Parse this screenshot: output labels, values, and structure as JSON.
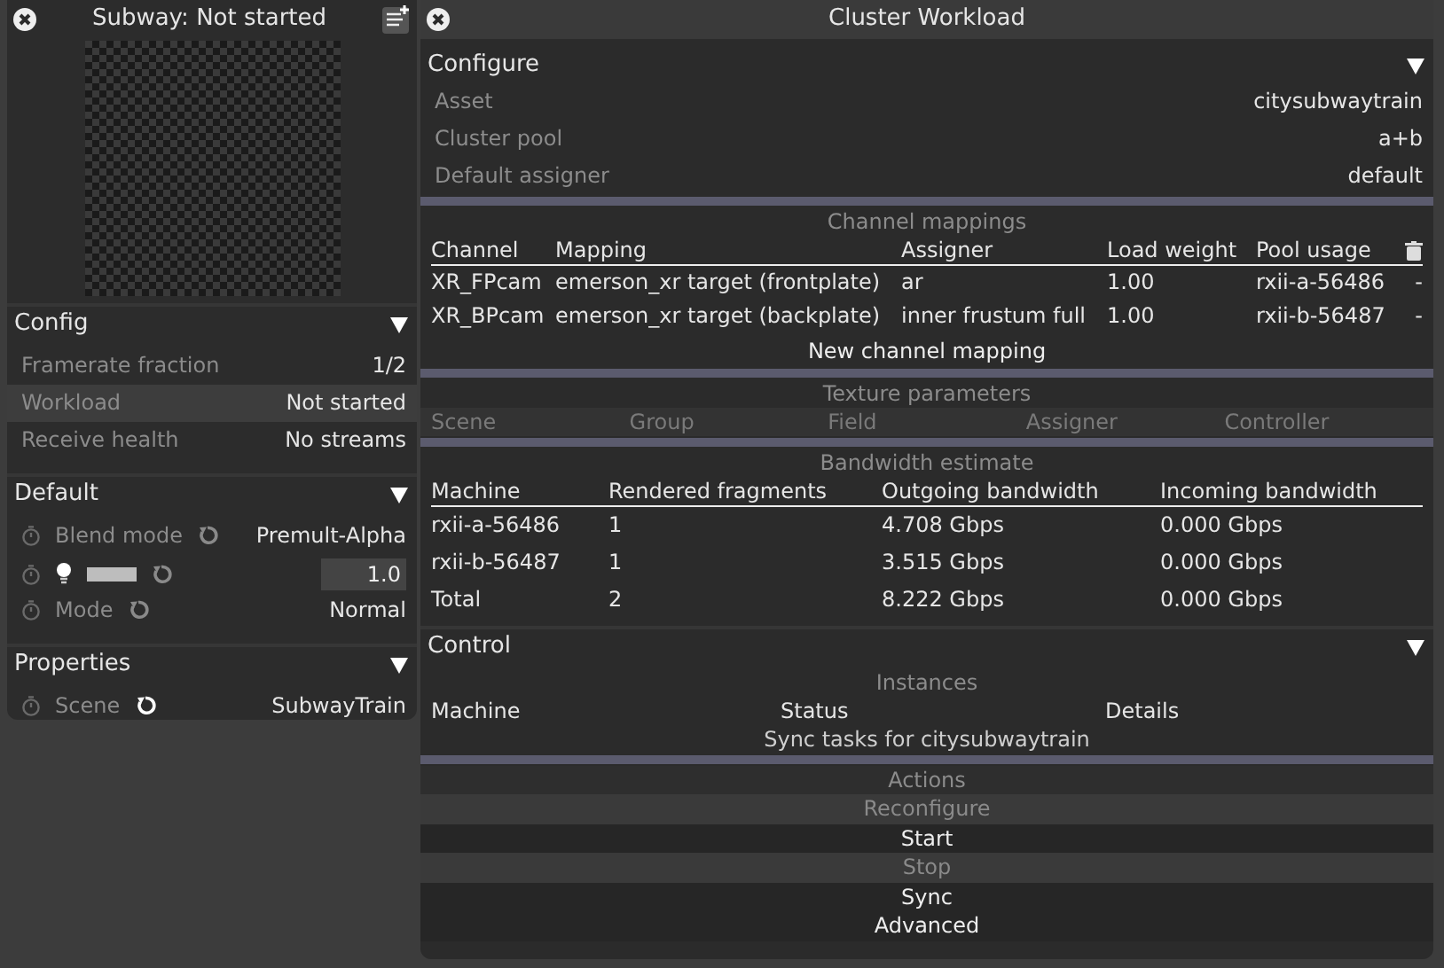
{
  "left_panel": {
    "title": "Subway: Not started",
    "sections": [
      {
        "title": "Config",
        "expanded": true,
        "rows": [
          {
            "kind": "info",
            "label": "Framerate fraction",
            "value": "1/2",
            "selected": false
          },
          {
            "kind": "info",
            "label": "Workload",
            "value": "Not started",
            "selected": true
          },
          {
            "kind": "info",
            "label": "Receive health",
            "value": "No streams",
            "selected": false
          }
        ]
      },
      {
        "title": "Default",
        "expanded": true,
        "rows": [
          {
            "kind": "select",
            "label": "Blend mode",
            "value": "Premult-Alpha",
            "modified": false
          },
          {
            "kind": "slider",
            "level": 1.0,
            "value": "1.0",
            "modified": false
          },
          {
            "kind": "select",
            "label": "Mode",
            "value": "Normal",
            "modified": false
          }
        ]
      },
      {
        "title": "Properties",
        "expanded": true,
        "rows": [
          {
            "kind": "select",
            "label": "Scene",
            "value": "SubwayTrain",
            "modified": true
          }
        ]
      }
    ]
  },
  "main_panel": {
    "title": "Cluster Workload",
    "configure": {
      "title": "Configure",
      "expanded": true,
      "rows": [
        {
          "label": "Asset",
          "value": "citysubwaytrain"
        },
        {
          "label": "Cluster pool",
          "value": "a+b"
        },
        {
          "label": "Default assigner",
          "value": "default"
        }
      ]
    },
    "channel_mappings": {
      "title": "Channel mappings",
      "columns": [
        "Channel",
        "Mapping",
        "Assigner",
        "Load weight",
        "Pool usage"
      ],
      "rows": [
        [
          "XR_FPcam",
          "emerson_xr target (frontplate)",
          "ar",
          "1.00",
          "rxii-a-56486",
          "-"
        ],
        [
          "XR_BPcam",
          "emerson_xr target (backplate)",
          "inner frustum full",
          "1.00",
          "rxii-b-56487",
          "-"
        ]
      ],
      "add_button": "New channel mapping"
    },
    "texture_parameters": {
      "title": "Texture parameters",
      "columns": [
        "Scene",
        "Group",
        "Field",
        "Assigner",
        "Controller"
      ]
    },
    "bandwidth": {
      "title": "Bandwidth estimate",
      "columns": [
        "Machine",
        "Rendered fragments",
        "Outgoing bandwidth",
        "Incoming bandwidth"
      ],
      "rows": [
        [
          "rxii-a-56486",
          "1",
          "4.708 Gbps",
          "0.000 Gbps"
        ],
        [
          "rxii-b-56487",
          "1",
          "3.515 Gbps",
          "0.000 Gbps"
        ],
        [
          "Total",
          "2",
          "8.222 Gbps",
          "0.000 Gbps"
        ]
      ]
    },
    "control": {
      "title": "Control",
      "expanded": true,
      "instances": {
        "title": "Instances",
        "columns": [
          "Machine",
          "Status",
          "Details"
        ],
        "note": "Sync tasks for citysubwaytrain"
      },
      "actions": {
        "title": "Actions",
        "buttons": [
          {
            "label": "Reconfigure",
            "disabled": true
          },
          {
            "label": "Start",
            "disabled": false
          },
          {
            "label": "Stop",
            "disabled": true
          },
          {
            "label": "Sync",
            "disabled": false
          },
          {
            "label": "Advanced",
            "disabled": false
          }
        ]
      }
    }
  }
}
